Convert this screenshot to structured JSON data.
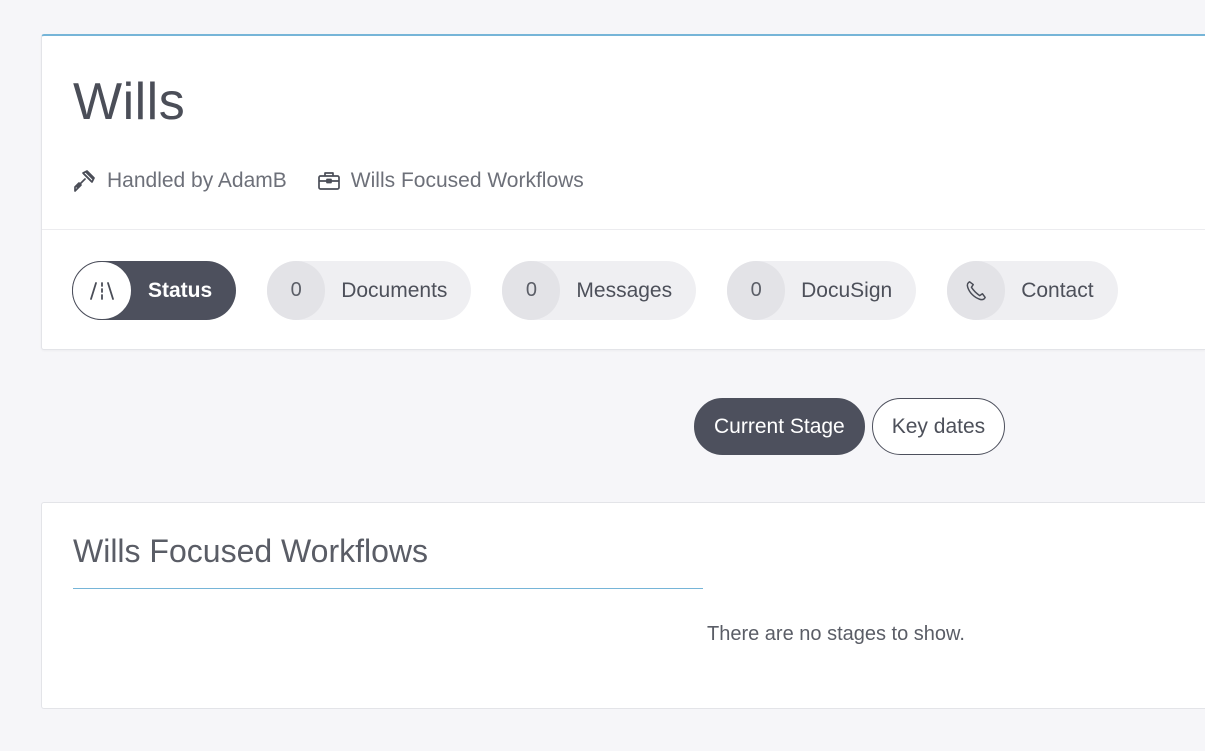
{
  "matter": {
    "title": "Wills",
    "handled_by": "Handled by AdamB",
    "workflow": "Wills Focused Workflows"
  },
  "tabs": [
    {
      "badge": "/i\\",
      "label": "Status",
      "active": true,
      "icon": "road-icon"
    },
    {
      "badge": "0",
      "label": "Documents",
      "active": false
    },
    {
      "badge": "0",
      "label": "Messages",
      "active": false
    },
    {
      "badge": "0",
      "label": "DocuSign",
      "active": false
    },
    {
      "badge": "",
      "label": "Contact",
      "active": false,
      "icon": "phone-icon"
    }
  ],
  "view_toggle": {
    "current_stage": "Current Stage",
    "key_dates": "Key dates",
    "selected": "current_stage"
  },
  "workflow_panel": {
    "title": "Wills Focused Workflows",
    "empty_message": "There are no stages to show."
  },
  "colors": {
    "accent_line": "#76b5d8",
    "active_pill": "#4d505d",
    "page_background": "#f6f6f9"
  }
}
